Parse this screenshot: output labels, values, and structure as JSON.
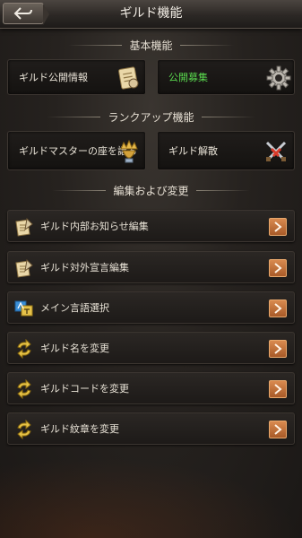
{
  "header": {
    "title": "ギルド機能"
  },
  "sections": {
    "basic": "基本機能",
    "rankup": "ランクアップ機能",
    "edit": "編集および変更"
  },
  "cards": {
    "guild_info": "ギルド公開情報",
    "recruit": "公開募集",
    "transfer_line1": "ギルドマスターの座",
    "transfer_line2": "を譲る",
    "disband": "ギルド解散"
  },
  "rows": [
    {
      "label": "ギルド内部お知らせ編集",
      "icon": "quill-paper-icon"
    },
    {
      "label": "ギルド対外宣言編集",
      "icon": "quill-paper-icon"
    },
    {
      "label": "メイン言語選択",
      "icon": "language-icon"
    },
    {
      "label": "ギルド名を変更",
      "icon": "swap-arrows-icon"
    },
    {
      "label": "ギルドコードを変更",
      "icon": "swap-arrows-icon"
    },
    {
      "label": "ギルド紋章を変更",
      "icon": "swap-arrows-icon"
    }
  ],
  "colors": {
    "accent_green": "#59d84e",
    "arrow_orange": "#c9733a",
    "background": "#26221f"
  }
}
